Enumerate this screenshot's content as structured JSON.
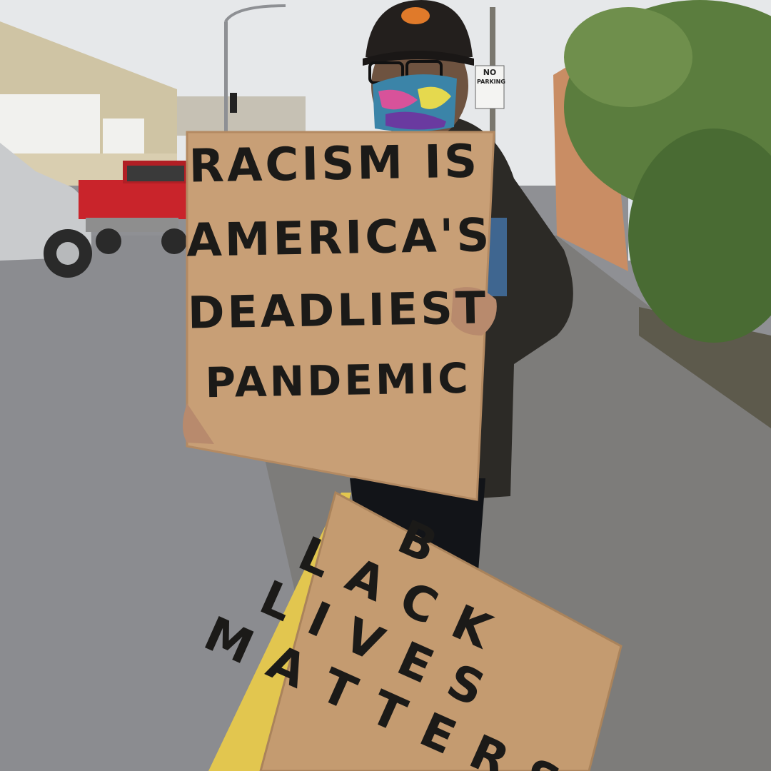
{
  "scene": {
    "colors": {
      "sky": "#e6e8ea",
      "asphalt": "#8b8c90",
      "sidewalk": "#7d7c7a",
      "curb_yellow": "#e2c64f",
      "cardboard": "#c89f76",
      "cardboard_dark": "#b48a62",
      "ink": "#1b1a18",
      "red_truck": "#c9242b",
      "silver_truck": "#c9cbcd",
      "jacket": "#2c2a26",
      "foliage": "#496b33"
    },
    "street_sign": {
      "lines": [
        "NO",
        "PARKING"
      ]
    },
    "upper_sign": {
      "lines": [
        "RACISM IS",
        "AMERICA'S",
        "DEADLIEST",
        "PANDEMIC"
      ]
    },
    "lower_sign": {
      "lines": [
        "B",
        "L A C K",
        "L I V E S",
        "M A T T E R S"
      ]
    }
  }
}
